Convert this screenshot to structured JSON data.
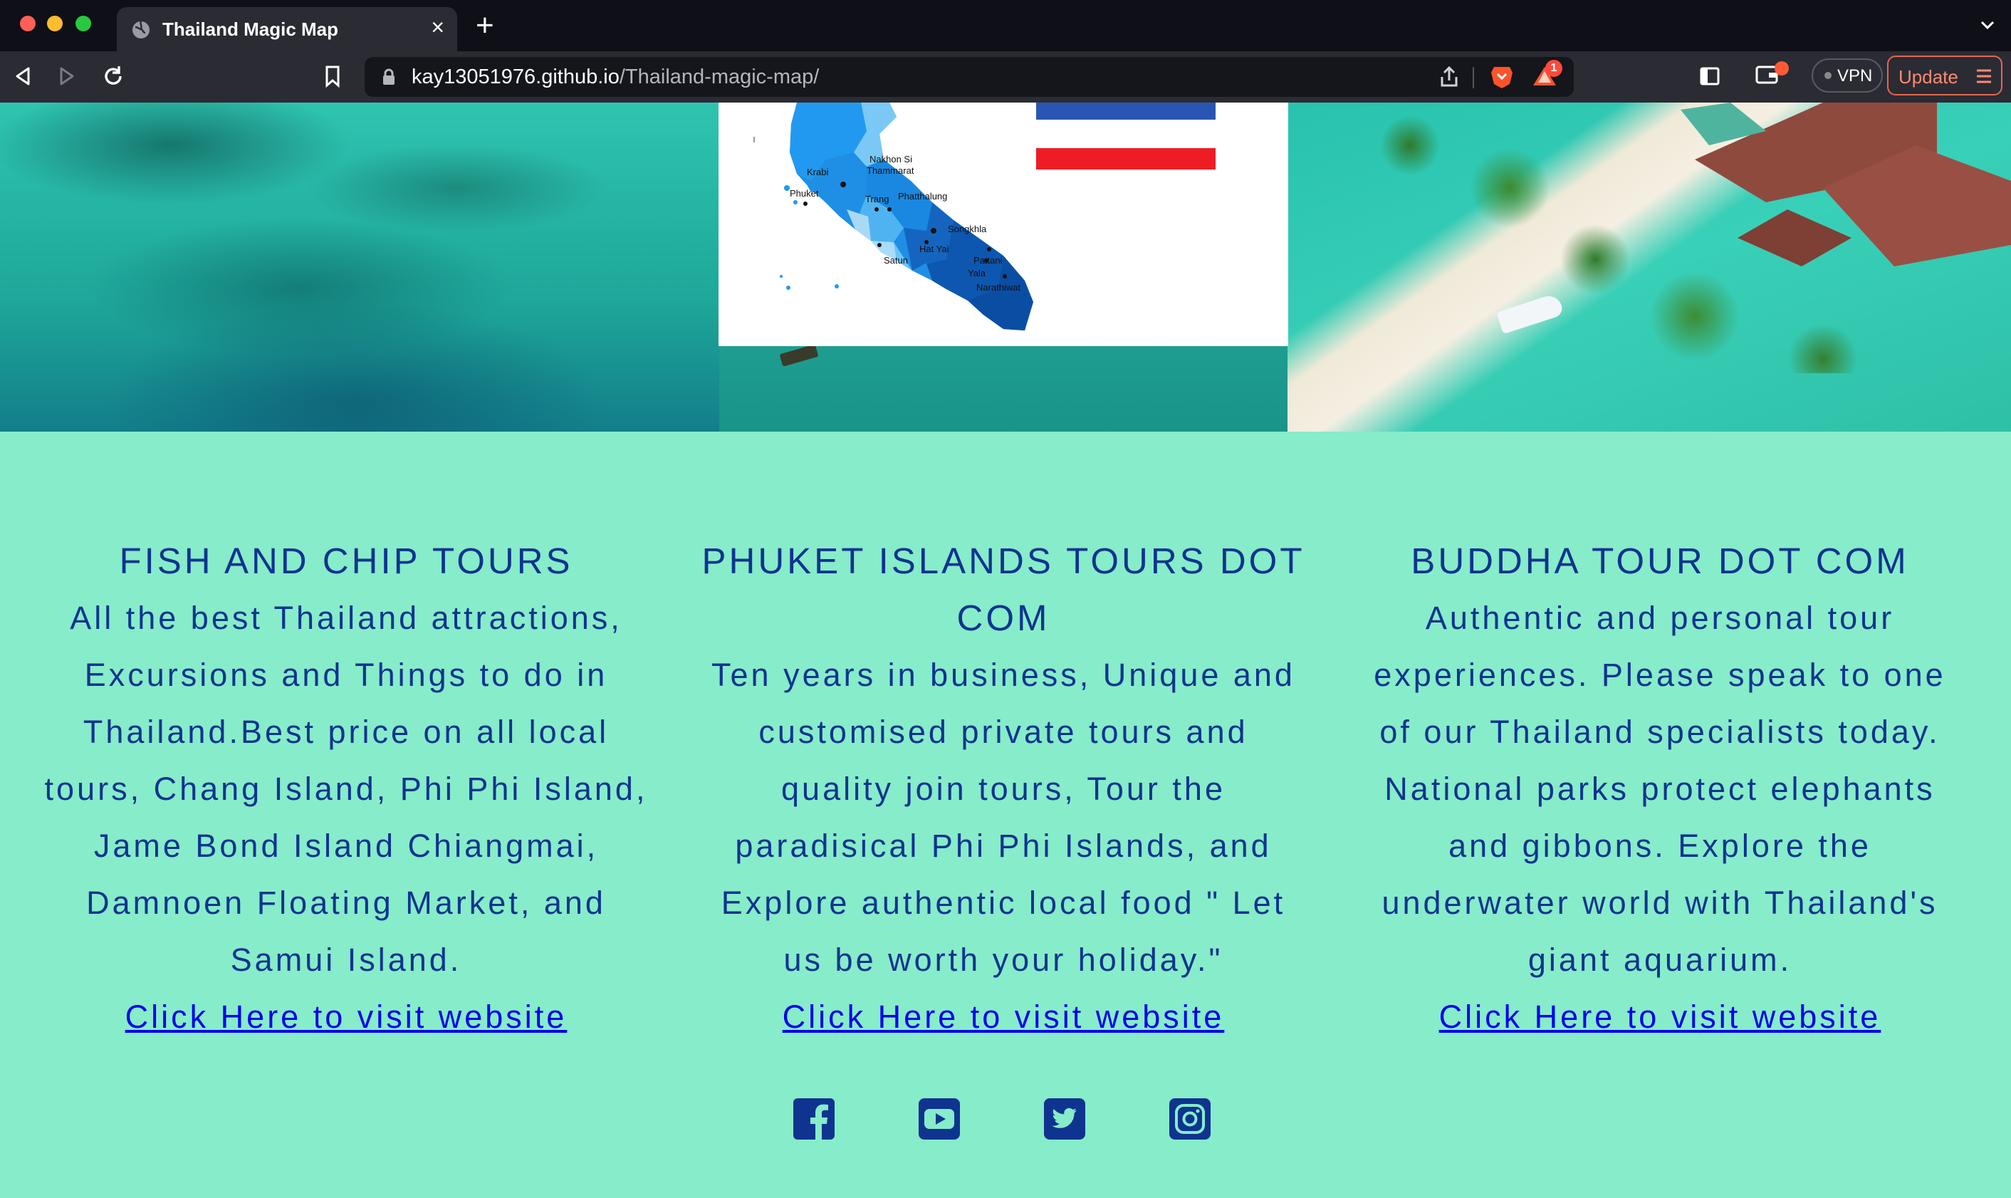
{
  "browser": {
    "tab_title": "Thailand Magic Map",
    "url_domain": "kay13051976.github.io",
    "url_path": "/Thailand-magic-map/",
    "vpn_label": "VPN",
    "update_label": "Update",
    "alert_count": "1"
  },
  "map": {
    "labels": [
      {
        "id": "nakhon",
        "text": "Nakhon Si"
      },
      {
        "id": "thammarat",
        "text": "Thammarat"
      },
      {
        "id": "krabi",
        "text": "Krabi"
      },
      {
        "id": "phuket",
        "text": "Phuket"
      },
      {
        "id": "trang",
        "text": "Trang"
      },
      {
        "id": "phatthalung",
        "text": "Phatthalung"
      },
      {
        "id": "songkhla",
        "text": "Songkhla"
      },
      {
        "id": "hatyai",
        "text": "Hat Yai"
      },
      {
        "id": "satun",
        "text": "Satun"
      },
      {
        "id": "pattani",
        "text": "Pattani"
      },
      {
        "id": "yala",
        "text": "Yala"
      },
      {
        "id": "narathiwat",
        "text": "Narathiwat"
      }
    ],
    "flag_colors": [
      "#2a55b3",
      "#ffffff",
      "#ee1c25"
    ]
  },
  "columns": [
    {
      "title": "FISH AND CHIP TOURS",
      "body": "All the best Thailand attractions, Excursions and Things to do in Thailand.Best price on all local tours, Chang Island, Phi Phi Island, Jame Bond Island Chiangmai, Damnoen Floating Market, and Samui Island.",
      "link": "Click Here to visit website"
    },
    {
      "title": "PHUKET ISLANDS TOURS DOT COM",
      "body": "Ten years in business, Unique and customised private tours and quality join tours, Tour the paradisical Phi Phi Islands, and Explore authentic local food \" Let us be worth your holiday.\"",
      "link": "Click Here to visit website"
    },
    {
      "title": "BUDDHA TOUR DOT COM",
      "body": "Authentic and personal tour experiences. Please speak to one of our Thailand specialists today. National parks protect elephants and gibbons. Explore the underwater world with Thailand's giant aquarium.",
      "link": "Click Here to visit website"
    }
  ],
  "social": [
    "facebook-icon",
    "youtube-icon",
    "twitter-icon",
    "instagram-icon"
  ],
  "colors": {
    "page_bg": "#87ecc9",
    "text": "#0e348f",
    "link": "#0000ee"
  }
}
